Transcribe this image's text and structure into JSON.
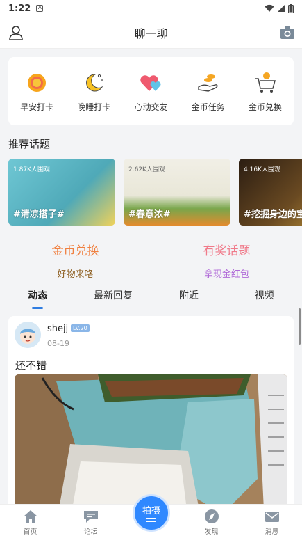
{
  "status_bar": {
    "time": "1:22",
    "notif_glyph": "A"
  },
  "header": {
    "title": "聊一聊",
    "left_icon": "user-icon",
    "right_icon": "camera-icon"
  },
  "quick_actions": [
    {
      "label": "早安打卡",
      "icon": "sun-icon"
    },
    {
      "label": "晚睡打卡",
      "icon": "moon-icon"
    },
    {
      "label": "心动交友",
      "icon": "hearts-icon"
    },
    {
      "label": "金币任务",
      "icon": "coin-hand-icon"
    },
    {
      "label": "金币兑换",
      "icon": "cart-icon"
    }
  ],
  "recommended": {
    "title": "推荐话题",
    "topics": [
      {
        "views": "1.87K人围观",
        "name": "#清凉搭子#"
      },
      {
        "views": "2.62K人围观",
        "name": "#春意浓#"
      },
      {
        "views": "4.16K人围观",
        "name": "#挖掘身边的宝"
      }
    ]
  },
  "promos": [
    {
      "title": "金币兑换",
      "subtitle": "好物来咯",
      "title_color": "#f08040",
      "subtitle_color": "#8a5a1a"
    },
    {
      "title": "有奖话题",
      "subtitle": "拿现金红包",
      "title_color": "#f07a8a",
      "subtitle_color": "#b06ad8"
    }
  ],
  "tabs": [
    "动态",
    "最新回复",
    "附近",
    "视频"
  ],
  "post": {
    "username": "shejj",
    "level": "LV.20",
    "date": "08-19",
    "text": "还不错"
  },
  "bottom_nav": {
    "items": [
      {
        "label": "首页",
        "icon": "home-icon"
      },
      {
        "label": "论坛",
        "icon": "chat-icon"
      },
      {
        "label": "发现",
        "icon": "compass-icon"
      },
      {
        "label": "消息",
        "icon": "mail-icon"
      }
    ],
    "center_label": "拍摄"
  },
  "colors": {
    "accent": "#2f7de1"
  }
}
